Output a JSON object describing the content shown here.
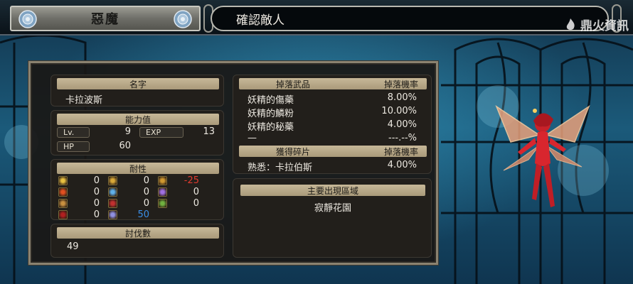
{
  "header": {
    "category": "惡魔",
    "title": "確認敵人",
    "watermark": "鼎火資訊"
  },
  "enemy": {
    "name_label": "名字",
    "name": "卡拉波斯",
    "stats_label": "能力值",
    "lv_label": "Lv.",
    "lv": "9",
    "exp_label": "EXP",
    "exp": "13",
    "hp_label": "HP",
    "hp": "60",
    "resist_label": "耐性",
    "resistances": [
      {
        "icon": "moon-icon",
        "value": "0"
      },
      {
        "icon": "wind-icon",
        "value": "0"
      },
      {
        "icon": "strike-icon",
        "value": "-25",
        "color": "#e03a2e"
      },
      {
        "icon": "fire-icon",
        "value": "0"
      },
      {
        "icon": "ice-icon",
        "value": "0"
      },
      {
        "icon": "lightning-icon",
        "value": "0"
      },
      {
        "icon": "earth-icon",
        "value": "0"
      },
      {
        "icon": "curse-icon",
        "value": "0"
      },
      {
        "icon": "poison-icon",
        "value": "0"
      },
      {
        "icon": "blood-icon",
        "value": "0"
      },
      {
        "icon": "holy-icon",
        "value": "50",
        "color": "#3a8ee6"
      }
    ],
    "kills_label": "討伐數",
    "kills": "49"
  },
  "drops": {
    "header_item": "掉落武品",
    "header_rate": "掉落機率",
    "items": [
      {
        "name": "妖精的傷藥",
        "rate": "8.00%"
      },
      {
        "name": "妖精的鱗粉",
        "rate": "10.00%"
      },
      {
        "name": "妖精的秘藥",
        "rate": "4.00%"
      },
      {
        "name": "—",
        "rate": "---.--%"
      }
    ]
  },
  "shards": {
    "header_item": "獲得碎片",
    "header_rate": "掉落機率",
    "items": [
      {
        "name": "熟悉：卡拉伯斯",
        "rate": "4.00%"
      }
    ]
  },
  "area": {
    "label": "主要出現區域",
    "name": "寂靜花園"
  },
  "colors": {
    "panel_border": "#8a8270",
    "label_bar": "#c7b898",
    "negative": "#e03a2e",
    "positive": "#3a8ee6",
    "fairy": "#d8262e"
  }
}
